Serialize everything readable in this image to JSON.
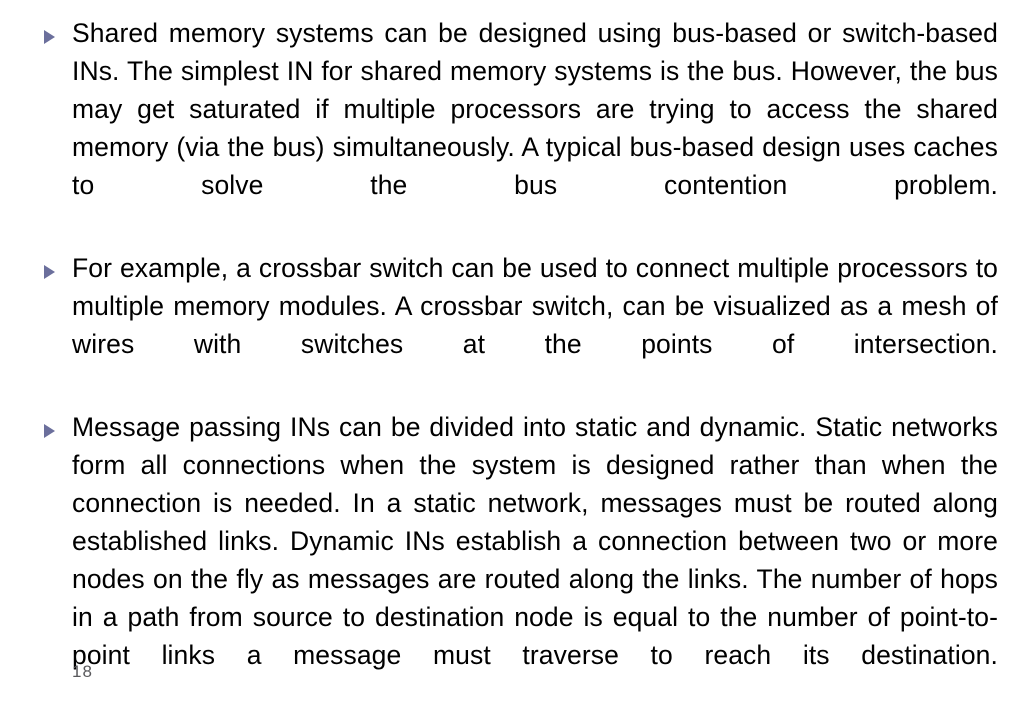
{
  "slide": {
    "background_color": "#ffffff",
    "text_color": "#000000",
    "bullet_marker_color": "#6b6f9c",
    "page_number_color": "#59595c",
    "bullet_icon": "triangle-right-icon"
  },
  "bullets": [
    {
      "text": "Shared memory systems can be designed using bus-based or switch-based INs. The simplest IN for shared memory systems is the bus. However, the bus may get saturated if multiple processors are trying to access the shared memory (via the bus) simultaneously. A typical bus-based design uses caches to solve the bus contention problem."
    },
    {
      "text": "For example, a crossbar switch can be used to connect multiple processors to multiple memory modules. A crossbar switch, can be visualized as a mesh of wires with switches at the points of intersection."
    },
    {
      "text": "Message passing INs can be divided into static and dynamic. Static networks form all connections when the system is designed rather than when the connection is needed. In a static network, messages must be routed along established links. Dynamic INs establish a connection between two or more nodes on the fly as messages are routed along the links. The number of hops in a path from source to destination node is equal to the number of point-to-point links a message must traverse to reach its destination."
    }
  ],
  "footer": {
    "page_number": "18"
  }
}
